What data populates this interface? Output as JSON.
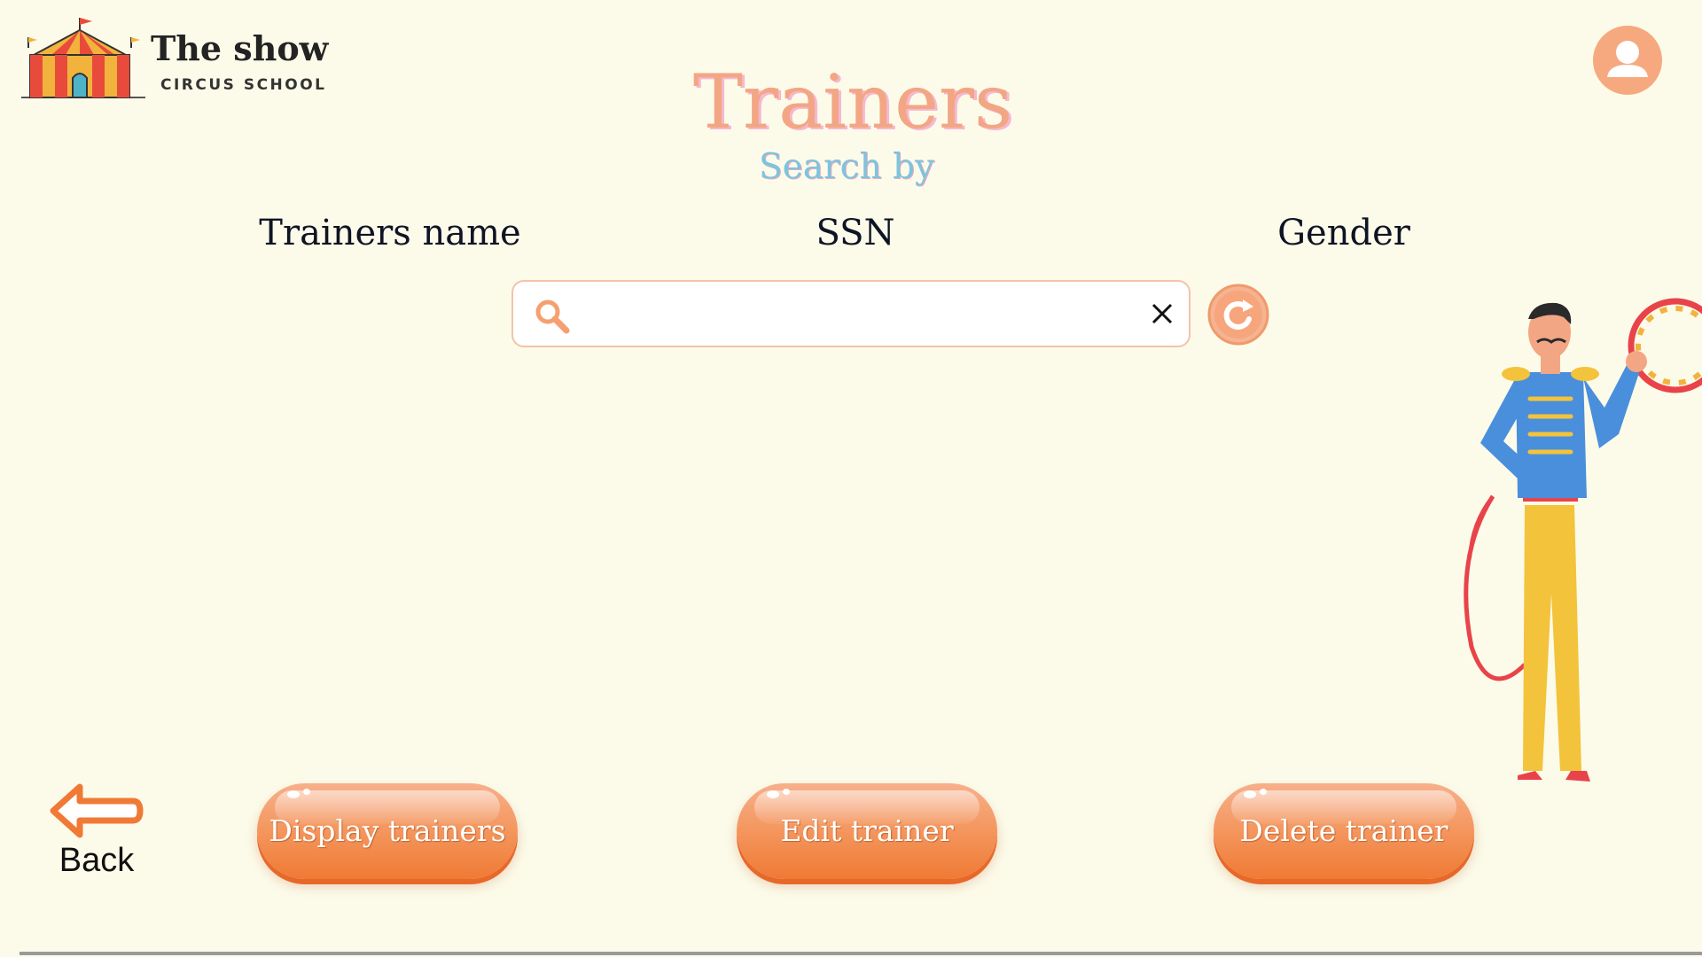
{
  "brand": {
    "title": "The show",
    "subtitle": "CIRCUS SCHOOL"
  },
  "page": {
    "title": "Trainers",
    "search_by": "Search by"
  },
  "criteria": [
    "Trainers name",
    "SSN",
    "Gender"
  ],
  "search": {
    "value": "",
    "placeholder": ""
  },
  "actions": {
    "display": "Display trainers",
    "edit": "Edit trainer",
    "delete": "Delete trainer"
  },
  "back": {
    "label": "Back"
  },
  "icons": {
    "logo": "circus-tent-icon",
    "avatar": "user-icon",
    "search": "search-icon",
    "clear": "close-icon",
    "refresh": "refresh-icon",
    "back": "arrow-left-icon"
  },
  "colors": {
    "background": "#fcfbea",
    "accent": "#f4a070",
    "title": "#f3a684",
    "subtitle": "#7dc4de",
    "text": "#0f1424"
  }
}
